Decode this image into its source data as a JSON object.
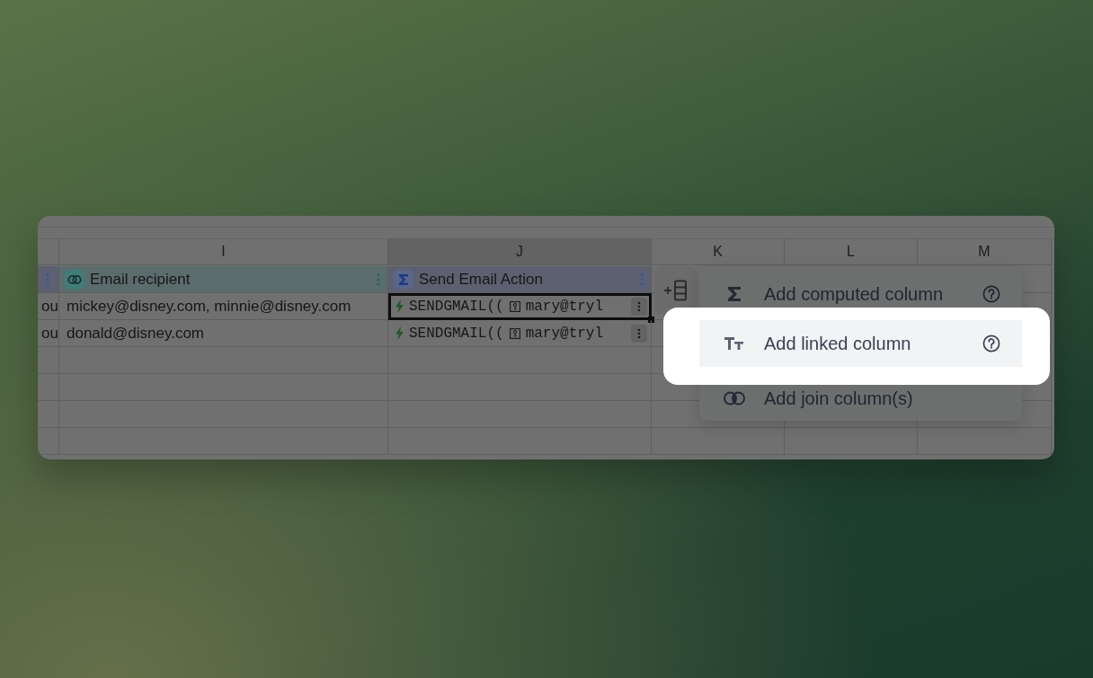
{
  "columns": [
    {
      "letter": "I",
      "selected": false
    },
    {
      "letter": "J",
      "selected": true
    },
    {
      "letter": "K",
      "selected": false
    },
    {
      "letter": "L",
      "selected": false
    },
    {
      "letter": "M",
      "selected": false
    }
  ],
  "fields": [
    {
      "name": "Email recipient",
      "kind": "join"
    },
    {
      "name": "Send Email Action",
      "kind": "computed"
    }
  ],
  "rows": [
    {
      "column_h": "ou",
      "email": "mickey@disney.com, minnie@disney.com",
      "action_prefix": "SENDGMAIL((",
      "action_value": "mary@tryl",
      "selected": true
    },
    {
      "column_h": "ou",
      "email": "donald@disney.com",
      "action_prefix": "SENDGMAIL((",
      "action_value": "mary@tryl",
      "selected": false
    }
  ],
  "menu": [
    {
      "label": "Add computed column",
      "kind": "computed",
      "help": true,
      "selected": false
    },
    {
      "label": "Add linked column",
      "kind": "linked",
      "help": true,
      "selected": true
    },
    {
      "label": "Add join column(s)",
      "kind": "join",
      "help": false,
      "selected": false
    }
  ]
}
